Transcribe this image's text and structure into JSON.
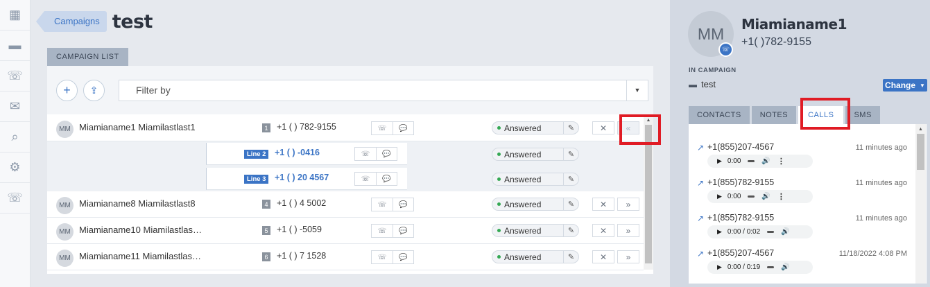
{
  "sidebar": {
    "items": [
      {
        "icon": "dashboard-icon",
        "glyph": "▦"
      },
      {
        "icon": "briefcase-icon",
        "glyph": "▬"
      },
      {
        "icon": "phone-list-icon",
        "glyph": "☏"
      },
      {
        "icon": "mail-icon",
        "glyph": "✉"
      },
      {
        "icon": "search-icon",
        "glyph": "⌕"
      },
      {
        "icon": "gear-icon",
        "glyph": "⚙"
      },
      {
        "icon": "phone-forward-icon",
        "glyph": "☏"
      }
    ]
  },
  "header": {
    "breadcrumb": "Campaigns",
    "title": "test"
  },
  "campaign_list": {
    "tab_label": "CAMPAIGN LIST",
    "add_glyph": "+",
    "upload_glyph": "⇪",
    "filter_placeholder": "Filter by",
    "rows": [
      {
        "type": "contact",
        "initials": "MM",
        "name": "Miamianame1 Miamilastlast1",
        "index": "1",
        "phone": "+1 (   ) 782-9155",
        "status": "Answered",
        "highlight": true
      },
      {
        "type": "line",
        "tag": "Line 2",
        "phone": "+1 (   )     -0416",
        "status": "Answered"
      },
      {
        "type": "line",
        "tag": "Line 3",
        "phone": "+1 (   ) 20    4567",
        "status": "Answered"
      },
      {
        "type": "contact",
        "initials": "MM",
        "name": "Miamianame8 Miamilastlast8",
        "index": "4",
        "phone": "+1 (   ) 4      5002",
        "status": "Answered",
        "highlight": false
      },
      {
        "type": "contact",
        "initials": "MM",
        "name": "Miamianame10 Miamilastlas…",
        "index": "5",
        "phone": "+1 (   )        -5059",
        "status": "Answered",
        "highlight": false
      },
      {
        "type": "contact",
        "initials": "MM",
        "name": "Miamianame11 Miamilastlas…",
        "index": "6",
        "phone": "+1 (   ) 7      1528",
        "status": "Answered",
        "highlight": false
      }
    ]
  },
  "contact_panel": {
    "initials": "MM",
    "name": "Miamianame1",
    "phone": "+1(       )782-9155",
    "in_campaign_label": "IN CAMPAIGN",
    "campaign_name": "test",
    "change_label": "Change",
    "tabs": [
      "CONTACTS",
      "NOTES",
      "CALLS",
      "SMS"
    ],
    "active_tab": "CALLS",
    "calls": [
      {
        "number": "+1(855)207-4567",
        "when": "11 minutes ago",
        "player_time": "0:00",
        "show_more": true
      },
      {
        "number": "+1(855)782-9155",
        "when": "11 minutes ago",
        "player_time": "0:00",
        "show_more": true
      },
      {
        "number": "+1(855)782-9155",
        "when": "11 minutes ago",
        "player_time": "0:00 / 0:02",
        "show_more": false
      },
      {
        "number": "+1(855)207-4567",
        "when": "11/18/2022 4:08 PM",
        "player_time": "0:00 / 0:19",
        "show_more": false
      }
    ]
  },
  "colors": {
    "accent": "#3b74c5",
    "highlight": "#e01b24",
    "answered_dot": "#34a853"
  }
}
